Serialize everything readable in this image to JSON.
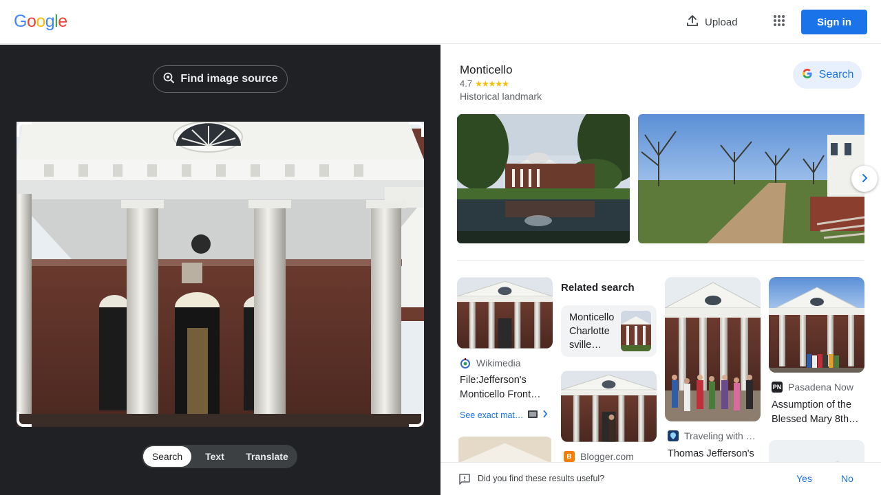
{
  "header": {
    "logo_letters": [
      {
        "char": "G",
        "color": "#4285f4"
      },
      {
        "char": "o",
        "color": "#ea4335"
      },
      {
        "char": "o",
        "color": "#fbbc05"
      },
      {
        "char": "g",
        "color": "#4285f4"
      },
      {
        "char": "l",
        "color": "#34a853"
      },
      {
        "char": "e",
        "color": "#ea4335"
      }
    ],
    "upload_label": "Upload",
    "upload_icon": "upload-icon",
    "apps_icon": "apps-grid-icon",
    "signin_label": "Sign in"
  },
  "left": {
    "find_source_label": "Find image source",
    "find_source_icon": "lens-search-icon",
    "tabs": [
      "Search",
      "Text",
      "Translate"
    ],
    "active_tab": "Search"
  },
  "knowledge_panel": {
    "title": "Monticello",
    "rating": "4.7",
    "stars": "★★★★★",
    "type": "Historical landmark",
    "search_label": "Search"
  },
  "results": {
    "item1": {
      "source": "Wikimedia",
      "title_line1": "File:Jefferson's",
      "title_line2": "Monticello Front…",
      "see_exact": "See exact mat…"
    },
    "related": {
      "heading": "Related search",
      "card_line1": "Monticello",
      "card_line2": "Charlotte",
      "card_line3": "sville…"
    },
    "item_blogger": {
      "source": "Blogger.com"
    },
    "item_travel": {
      "source": "Traveling with …",
      "title_line1": "Thomas Jefferson's"
    },
    "item_pasadena": {
      "source": "Pasadena Now",
      "source_icon_text": "PN",
      "title_line1": "Assumption of the",
      "title_line2": "Blessed Mary 8th…"
    }
  },
  "feedback": {
    "question": "Did you find these results useful?",
    "yes": "Yes",
    "no": "No"
  },
  "colors": {
    "accent": "#1a73e8",
    "dark_pane": "#202124",
    "star": "#fbbc04"
  }
}
